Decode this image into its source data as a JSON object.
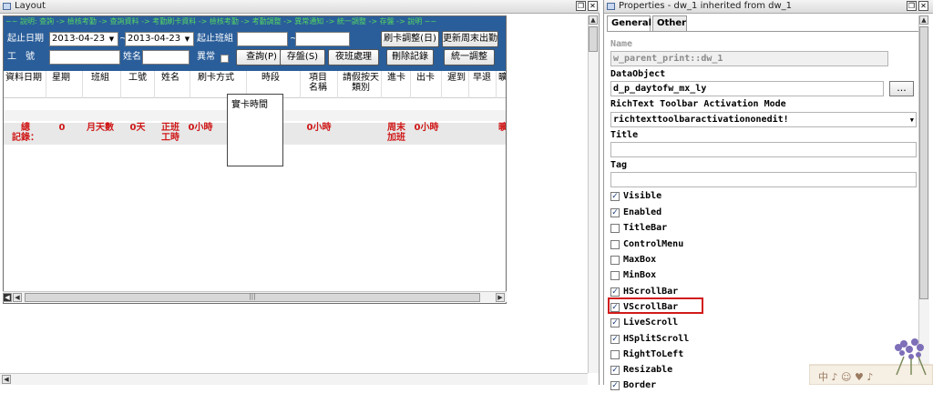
{
  "layout_pane": {
    "title": "Layout",
    "ticker": "~~ 說明: 查詢 -> 檢核考勤 -> 查詢資料 -> 考勤刷卡資料 -> 檢核考勤 -> 考勤調整 -> 異常通知 -> 統一調整 -> 存盤 -> 說明 ~~",
    "header": {
      "start_date_label": "起止日期",
      "start_date_value": "2013-04-23",
      "end_date_value": "2013-04-23",
      "date_sep": "~",
      "shift_label": "起止班組",
      "shift_sep": "~",
      "emp_id_label": "工　號",
      "name_label": "姓名",
      "abnormal_label": "異常",
      "btn_card_adjust": "刷卡調整(日)",
      "btn_update_weekend": "更新周末出勤",
      "btn_query": "查詢(P)",
      "btn_save": "存盤(S)",
      "btn_night": "夜班處理",
      "btn_delete": "刪除記錄",
      "btn_unify": "統一調整"
    },
    "columns": [
      "資料日期",
      "星期",
      "班組",
      "工號",
      "姓名",
      "刷卡方式",
      "時段",
      "項目\n名稱",
      "請假按天\n類別",
      "進卡",
      "出卡",
      "遲到",
      "早退",
      "曠"
    ],
    "summary": [
      "總\n記錄：",
      "0",
      "月天數",
      "0天",
      "正班\n工時",
      "0小時",
      "0小時",
      "周末\n加班",
      "0小時",
      "曠"
    ],
    "popup_text": "實卡時間",
    "scroll_thumb": "|||"
  },
  "props_pane": {
    "title": "Properties - dw_1 inherited from dw_1",
    "tabs": [
      "General",
      "Other"
    ],
    "name_label": "Name",
    "name_value": "w_parent_print::dw_1",
    "dataobject_label": "DataObject",
    "dataobject_value": "d_p_daytofw_mx_ly",
    "dots": "...",
    "richtext_label": "RichText Toolbar Activation Mode",
    "richtext_value": "richtexttoolbaractivationonedit!",
    "title_label": "Title",
    "title_value": "",
    "tag_label": "Tag",
    "tag_value": "",
    "checkboxes": [
      {
        "label": "Visible",
        "checked": true
      },
      {
        "label": "Enabled",
        "checked": true
      },
      {
        "label": "TitleBar",
        "checked": false
      },
      {
        "label": "ControlMenu",
        "checked": false
      },
      {
        "label": "MaxBox",
        "checked": false
      },
      {
        "label": "MinBox",
        "checked": false
      },
      {
        "label": "HScrollBar",
        "checked": true
      },
      {
        "label": "VScrollBar",
        "checked": true
      },
      {
        "label": "LiveScroll",
        "checked": true
      },
      {
        "label": "HSplitScroll",
        "checked": true
      },
      {
        "label": "RightToLeft",
        "checked": false
      },
      {
        "label": "Resizable",
        "checked": true
      },
      {
        "label": "Border",
        "checked": true
      }
    ]
  },
  "colors": {
    "header_bg": "#2a5e9a",
    "ticker_text": "#56d860",
    "summary_red": "#d01818",
    "highlight": "#d21a1a"
  },
  "deco_text": "中 ♪ ☺ ♥ ♪"
}
